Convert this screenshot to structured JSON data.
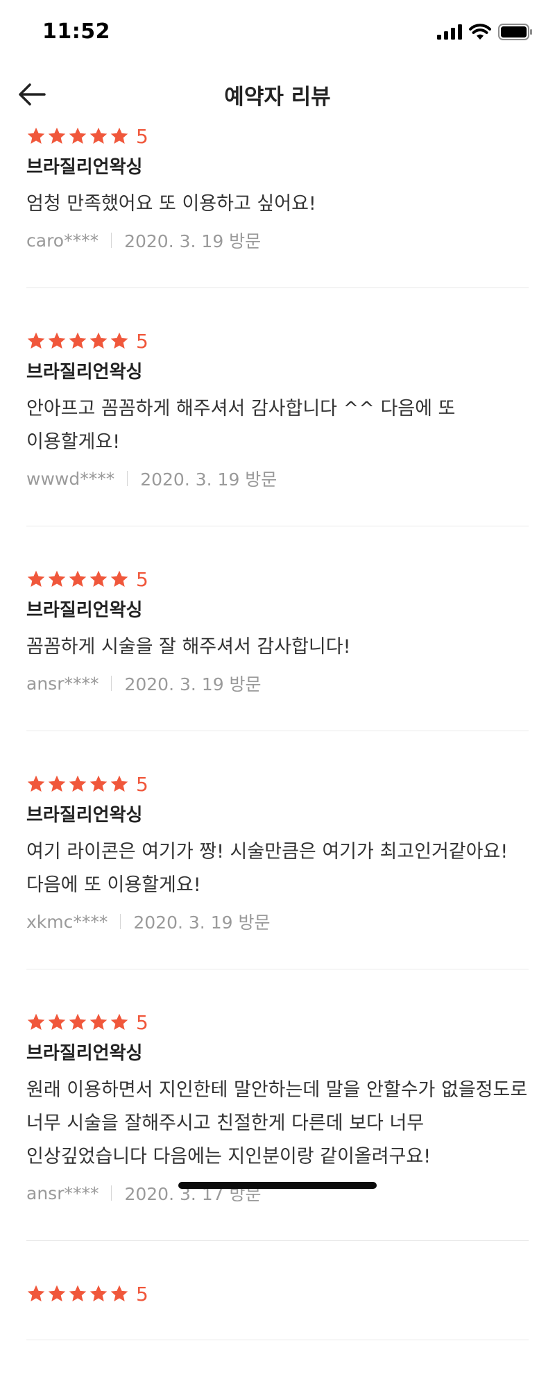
{
  "status_bar": {
    "time": "11:52"
  },
  "header": {
    "title": "예약자 리뷰",
    "back_icon": "arrow-left-icon"
  },
  "colors": {
    "star": "#f0573b",
    "meta": "#9a9a9a",
    "divider": "#e8e8e8"
  },
  "reviews": [
    {
      "rating": "5",
      "stars": 5,
      "service": "브라질리언왁싱",
      "text": "엄청 만족했어요 또 이용하고 싶어요!",
      "user": "caro****",
      "date": "2020. 3. 19 방문"
    },
    {
      "rating": "5",
      "stars": 5,
      "service": "브라질리언왁싱",
      "text": "안아프고 꼼꼼하게 해주셔서 감사합니다 ^^ 다음에 또 이용할게요!",
      "user": "wwwd****",
      "date": "2020. 3. 19 방문"
    },
    {
      "rating": "5",
      "stars": 5,
      "service": "브라질리언왁싱",
      "text": "꼼꼼하게 시술을 잘 해주셔서 감사합니다!",
      "user": "ansr****",
      "date": "2020. 3. 19 방문"
    },
    {
      "rating": "5",
      "stars": 5,
      "service": "브라질리언왁싱",
      "text": "여기 라이콘은 여기가 짱! 시술만큼은 여기가 최고인거같아요! 다음에 또 이용할게요!",
      "user": "xkmc****",
      "date": "2020. 3. 19 방문"
    },
    {
      "rating": "5",
      "stars": 5,
      "service": "브라질리언왁싱",
      "text": "원래 이용하면서 지인한테 말안하는데 말을 안할수가 없을정도로 너무 시술을 잘해주시고 친절한게 다른데 보다 너무 인상깊었습니다 다음에는 지인분이랑 같이올려구요!",
      "user": "ansr****",
      "date": "2020. 3. 17 방문"
    },
    {
      "rating": "5",
      "stars": 5,
      "service": "",
      "text": "",
      "user": "",
      "date": ""
    }
  ]
}
